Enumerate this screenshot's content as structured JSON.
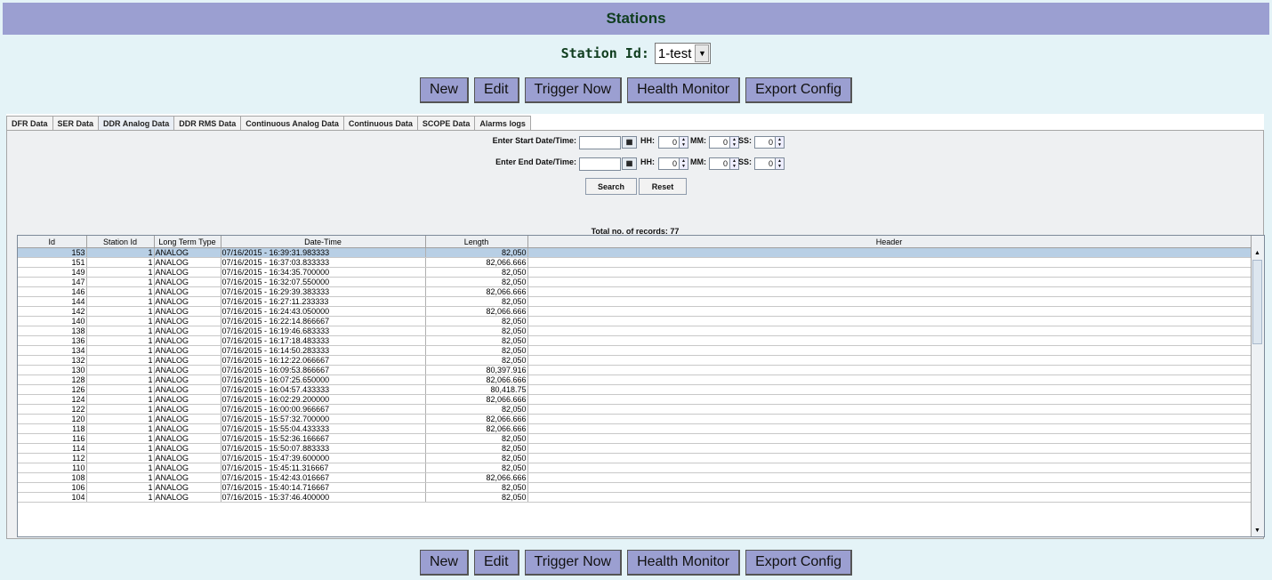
{
  "header": {
    "title": "Stations"
  },
  "station": {
    "label": "Station Id:",
    "value": "1-test"
  },
  "actions": [
    "New",
    "Edit",
    "Trigger Now",
    "Health Monitor",
    "Export Config"
  ],
  "tabs": [
    "DFR Data",
    "SER Data",
    "DDR Analog Data",
    "DDR RMS Data",
    "Continuous Analog Data",
    "Continuous Data",
    "SCOPE Data",
    "Alarms logs"
  ],
  "active_tab": "DDR Analog Data",
  "filters": {
    "start_label": "Enter Start Date/Time:",
    "end_label": "Enter End Date/Time:",
    "hh_label": "HH:",
    "mm_label": "MM:",
    "ss_label": "SS:",
    "start": {
      "hh": "0",
      "mm": "0",
      "ss": "0"
    },
    "end": {
      "hh": "0",
      "mm": "0",
      "ss": "0"
    },
    "search_label": "Search",
    "reset_label": "Reset"
  },
  "total_text": "Total no. of records: 77",
  "table": {
    "columns": [
      "Id",
      "Station Id",
      "Long Term Type",
      "Date-Time",
      "Length",
      "Header"
    ],
    "rows": [
      [
        "153",
        "1",
        "ANALOG",
        "07/16/2015 - 16:39:31.983333",
        "82,050",
        ""
      ],
      [
        "151",
        "1",
        "ANALOG",
        "07/16/2015 - 16:37:03.833333",
        "82,066.666",
        ""
      ],
      [
        "149",
        "1",
        "ANALOG",
        "07/16/2015 - 16:34:35.700000",
        "82,050",
        ""
      ],
      [
        "147",
        "1",
        "ANALOG",
        "07/16/2015 - 16:32:07.550000",
        "82,050",
        ""
      ],
      [
        "146",
        "1",
        "ANALOG",
        "07/16/2015 - 16:29:39.383333",
        "82,066.666",
        ""
      ],
      [
        "144",
        "1",
        "ANALOG",
        "07/16/2015 - 16:27:11.233333",
        "82,050",
        ""
      ],
      [
        "142",
        "1",
        "ANALOG",
        "07/16/2015 - 16:24:43.050000",
        "82,066.666",
        ""
      ],
      [
        "140",
        "1",
        "ANALOG",
        "07/16/2015 - 16:22:14.866667",
        "82,050",
        ""
      ],
      [
        "138",
        "1",
        "ANALOG",
        "07/16/2015 - 16:19:46.683333",
        "82,050",
        ""
      ],
      [
        "136",
        "1",
        "ANALOG",
        "07/16/2015 - 16:17:18.483333",
        "82,050",
        ""
      ],
      [
        "134",
        "1",
        "ANALOG",
        "07/16/2015 - 16:14:50.283333",
        "82,050",
        ""
      ],
      [
        "132",
        "1",
        "ANALOG",
        "07/16/2015 - 16:12:22.066667",
        "82,050",
        ""
      ],
      [
        "130",
        "1",
        "ANALOG",
        "07/16/2015 - 16:09:53.866667",
        "80,397.916",
        ""
      ],
      [
        "128",
        "1",
        "ANALOG",
        "07/16/2015 - 16:07:25.650000",
        "82,066.666",
        ""
      ],
      [
        "126",
        "1",
        "ANALOG",
        "07/16/2015 - 16:04:57.433333",
        "80,418.75",
        ""
      ],
      [
        "124",
        "1",
        "ANALOG",
        "07/16/2015 - 16:02:29.200000",
        "82,066.666",
        ""
      ],
      [
        "122",
        "1",
        "ANALOG",
        "07/16/2015 - 16:00:00.966667",
        "82,050",
        ""
      ],
      [
        "120",
        "1",
        "ANALOG",
        "07/16/2015 - 15:57:32.700000",
        "82,066.666",
        ""
      ],
      [
        "118",
        "1",
        "ANALOG",
        "07/16/2015 - 15:55:04.433333",
        "82,066.666",
        ""
      ],
      [
        "116",
        "1",
        "ANALOG",
        "07/16/2015 - 15:52:36.166667",
        "82,050",
        ""
      ],
      [
        "114",
        "1",
        "ANALOG",
        "07/16/2015 - 15:50:07.883333",
        "82,050",
        ""
      ],
      [
        "112",
        "1",
        "ANALOG",
        "07/16/2015 - 15:47:39.600000",
        "82,050",
        ""
      ],
      [
        "110",
        "1",
        "ANALOG",
        "07/16/2015 - 15:45:11.316667",
        "82,050",
        ""
      ],
      [
        "108",
        "1",
        "ANALOG",
        "07/16/2015 - 15:42:43.016667",
        "82,066.666",
        ""
      ],
      [
        "106",
        "1",
        "ANALOG",
        "07/16/2015 - 15:40:14.716667",
        "82,050",
        ""
      ],
      [
        "104",
        "1",
        "ANALOG",
        "07/16/2015 - 15:37:46.400000",
        "82,050",
        ""
      ]
    ]
  },
  "icons": {
    "calendar": "calendar-icon",
    "dropdown": "chevron-down-icon",
    "spin_up": "spin-up-icon",
    "spin_down": "spin-down-icon"
  },
  "colors": {
    "header_bg": "#9b9fd1",
    "button_bg": "#9b9fd1",
    "page_bg": "#e4f3f7",
    "selected_row": "#b8cfe5"
  }
}
